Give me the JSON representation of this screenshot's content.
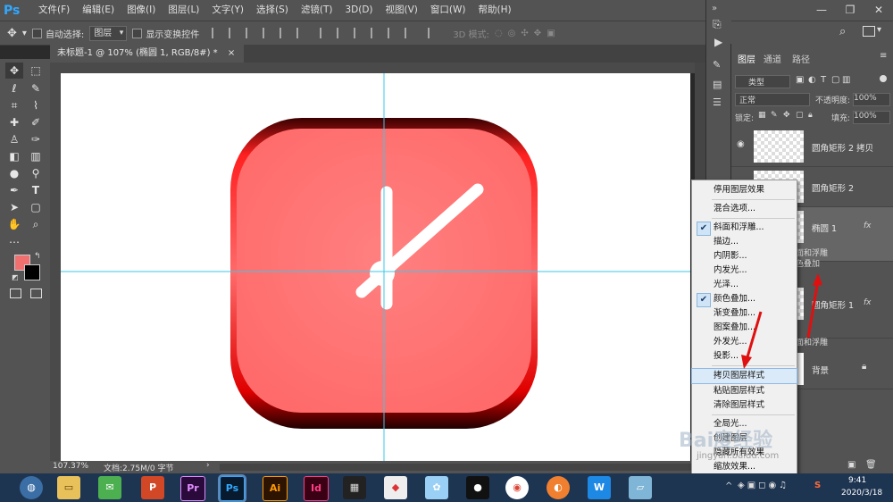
{
  "app": {
    "logo": "Ps"
  },
  "menubar": [
    "文件(F)",
    "编辑(E)",
    "图像(I)",
    "图层(L)",
    "文字(Y)",
    "选择(S)",
    "滤镜(T)",
    "3D(D)",
    "视图(V)",
    "窗口(W)",
    "帮助(H)"
  ],
  "window_controls": [
    "—",
    "❐",
    "✕"
  ],
  "options": {
    "auto_select_label": "自动选择:",
    "auto_select_value": "图层",
    "transform_label": "显示变换控件",
    "mode_3d": "3D 模式:"
  },
  "document": {
    "tab_title": "未标题-1 @ 107% (椭圆 1, RGB/8#) *",
    "tab_close": "×",
    "zoom": "107.37%",
    "doc_info": "文档:2.75M/0 字节"
  },
  "colors": {
    "foreground": "#f07070",
    "background": "#000000"
  },
  "panel": {
    "tabs": [
      "图层",
      "通道",
      "路径"
    ],
    "filter_kind": "类型",
    "blend_mode": "正常",
    "opacity_label": "不透明度:",
    "opacity_value": "100%",
    "lock_label": "锁定:",
    "fill_label": "填充:",
    "fill_value": "100%",
    "layers": [
      {
        "name": "圆角矩形 2 拷贝",
        "fx": ""
      },
      {
        "name": "圆角矩形 2",
        "fx": ""
      },
      {
        "name": "椭圆 1",
        "fx": "fx"
      },
      {
        "name": "圆角矩形 1",
        "fx": "fx"
      },
      {
        "name": "背景",
        "fx": ""
      }
    ],
    "partial_labels": [
      "面和浮雕",
      "色叠加",
      "面和浮雕"
    ]
  },
  "context_menu": {
    "items": [
      {
        "label": "停用图层效果",
        "checked": false
      },
      {
        "label": "混合选项...",
        "checked": false
      },
      {
        "label": "斜面和浮雕...",
        "checked": true
      },
      {
        "label": "描边...",
        "checked": false
      },
      {
        "label": "内阴影...",
        "checked": false
      },
      {
        "label": "内发光...",
        "checked": false
      },
      {
        "label": "光泽...",
        "checked": false
      },
      {
        "label": "颜色叠加...",
        "checked": true
      },
      {
        "label": "渐变叠加...",
        "checked": false
      },
      {
        "label": "图案叠加...",
        "checked": false
      },
      {
        "label": "外发光...",
        "checked": false
      },
      {
        "label": "投影...",
        "checked": false
      },
      {
        "label": "拷贝图层样式",
        "checked": false,
        "highlighted": true
      },
      {
        "label": "粘贴图层样式",
        "checked": false
      },
      {
        "label": "清除图层样式",
        "checked": false
      },
      {
        "label": "全局光...",
        "checked": false
      },
      {
        "label": "创建图层",
        "checked": false
      },
      {
        "label": "隐藏所有效果",
        "checked": false
      },
      {
        "label": "缩放效果...",
        "checked": false
      }
    ],
    "check_glyph": "✔"
  },
  "taskbar": {
    "apps": [
      "Pr",
      "Ps",
      "Ai",
      "Id",
      "W"
    ],
    "clock_time": "9:41",
    "clock_date": "2020/3/18",
    "ime": "S"
  },
  "watermark": {
    "text": "Bai度经验",
    "url": "jingyan.baidu.com"
  }
}
